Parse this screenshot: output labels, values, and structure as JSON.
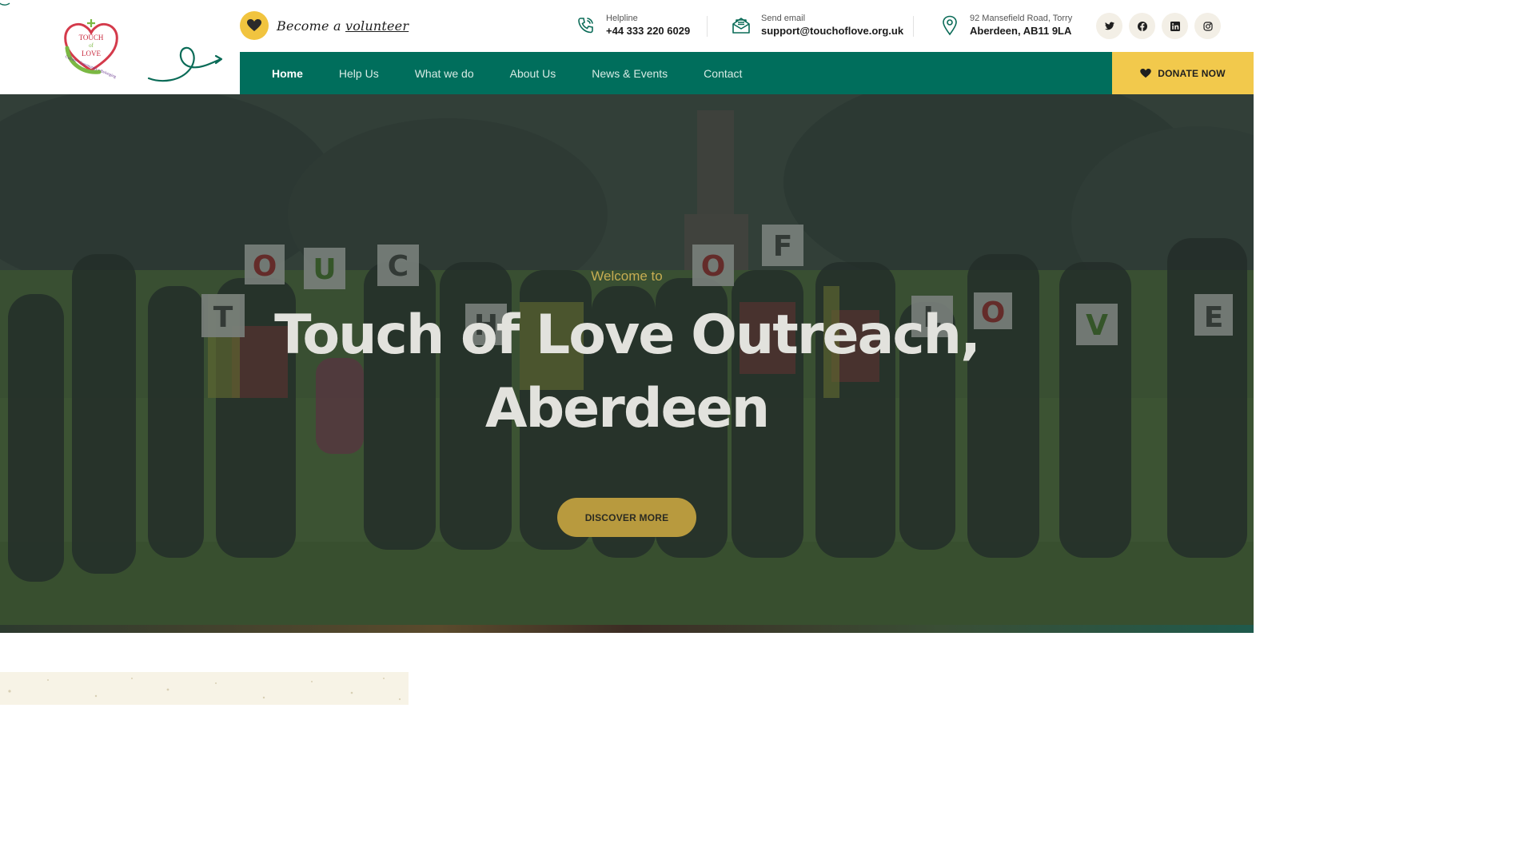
{
  "brand": {
    "logo_text_top": "TOUCH",
    "logo_text_of": "of",
    "logo_text_bottom": "LOVE",
    "logo_tagline": "Culture • Community • Belonging",
    "colors": {
      "primary_green": "#006e5c",
      "accent_yellow": "#f2c94c",
      "logo_red": "#c8283c"
    }
  },
  "volunteer": {
    "prefix": "Become a",
    "link_text": "volunteer",
    "icon": "heart-icon"
  },
  "contact": {
    "helpline_label": "Helpline",
    "helpline_value": "+44 333 220 6029",
    "email_label": "Send email",
    "email_value": "support@touchoflove.org.uk",
    "address_line1": "92 Mansefield Road, Torry",
    "address_line2": "Aberdeen, AB11 9LA"
  },
  "socials": [
    {
      "name": "twitter",
      "icon": "twitter-icon"
    },
    {
      "name": "facebook",
      "icon": "facebook-icon"
    },
    {
      "name": "linkedin",
      "icon": "linkedin-icon"
    },
    {
      "name": "instagram",
      "icon": "instagram-icon"
    }
  ],
  "nav": {
    "items": [
      {
        "label": "Home",
        "active": true
      },
      {
        "label": "Help Us",
        "active": false
      },
      {
        "label": "What we do",
        "active": false
      },
      {
        "label": "About Us",
        "active": false
      },
      {
        "label": "News & Events",
        "active": false
      },
      {
        "label": "Contact",
        "active": false
      }
    ],
    "donate_label": "DONATE NOW"
  },
  "hero": {
    "welcome": "Welcome to",
    "title_line1": "Touch of Love Outreach,",
    "title_line2": "Aberdeen",
    "cta_label": "DISCOVER MORE",
    "sign_letters": [
      "T",
      "O",
      "U",
      "C",
      "H",
      "O",
      "F",
      "L",
      "O",
      "V",
      "E"
    ]
  }
}
